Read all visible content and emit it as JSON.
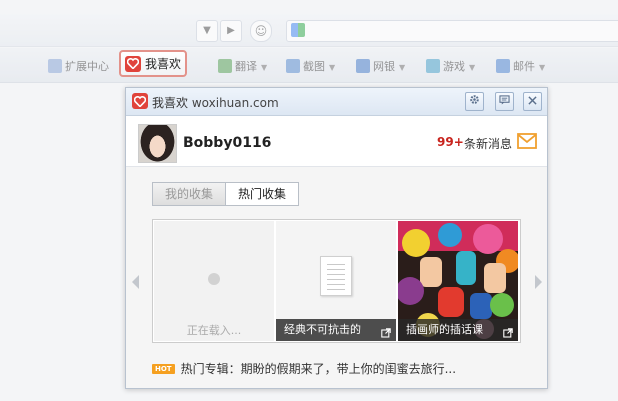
{
  "toolbar": {
    "items": [
      {
        "label": "扩展中心",
        "icon": "extension-icon"
      },
      {
        "label": "翻译",
        "icon": "translate-icon"
      },
      {
        "label": "截图",
        "icon": "screenshot-icon"
      },
      {
        "label": "网银",
        "icon": "bank-icon"
      },
      {
        "label": "游戏",
        "icon": "game-icon"
      },
      {
        "label": "邮件",
        "icon": "mail-icon"
      }
    ],
    "fav_button": "我喜欢"
  },
  "panel": {
    "title_cn": "我喜欢",
    "title_domain": "woxihuan.com",
    "header_buttons": [
      "gear-icon",
      "comment-icon",
      "close-icon"
    ],
    "user": {
      "name": "Bobby0116",
      "message_count": "99+",
      "message_label": "条新消息"
    },
    "tabs": [
      {
        "label": "我的收集",
        "active": false
      },
      {
        "label": "热门收集",
        "active": true
      }
    ],
    "gallery": [
      {
        "caption": "正在载入..."
      },
      {
        "caption": "经典不可抗击的"
      },
      {
        "caption": "插画师的插话课"
      }
    ],
    "hot": {
      "badge": "HOT",
      "text": "热门专辑：期盼的假期来了，带上你的闺蜜去旅行..."
    }
  },
  "colors": {
    "brand_red": "#e0433b",
    "highlight_border": "#e3928a",
    "message_red": "#c8231d",
    "mail_orange": "#f0a030",
    "hot_orange": "#f5a020"
  }
}
